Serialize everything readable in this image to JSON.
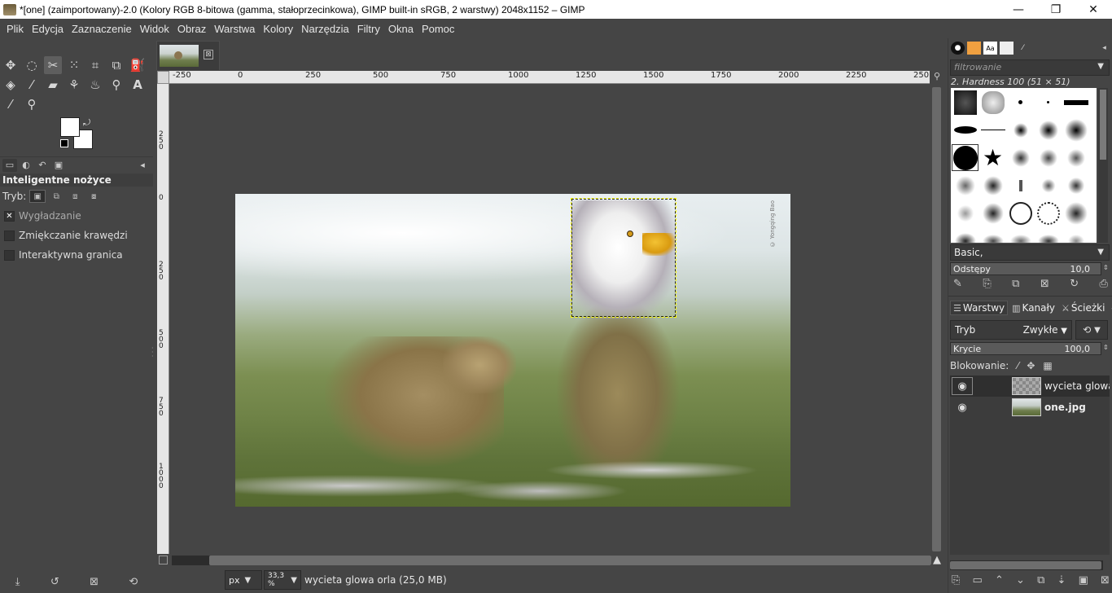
{
  "window": {
    "title": "*[one] (zaimportowany)-2.0 (Kolory RGB 8-bitowa (gamma, stałoprzecinkowa), GIMP built-in sRGB, 2 warstwy) 2048x1152 – GIMP",
    "minimize": "—",
    "maximize": "❐",
    "close": "✕"
  },
  "menu": [
    "Plik",
    "Edycja",
    "Zaznaczenie",
    "Widok",
    "Obraz",
    "Warstwa",
    "Kolory",
    "Narzędzia",
    "Filtry",
    "Okna",
    "Pomoc"
  ],
  "toolbox": {
    "tools": [
      {
        "name": "move-tool",
        "glyph": "✥"
      },
      {
        "name": "ellipse-select-tool",
        "glyph": "◌"
      },
      {
        "name": "scissors-select-tool",
        "glyph": "✂"
      },
      {
        "name": "fuzzy-select-tool",
        "glyph": "⁙"
      },
      {
        "name": "crop-tool",
        "glyph": "⌗"
      },
      {
        "name": "unified-transform-tool",
        "glyph": "⧉"
      },
      {
        "name": "warp-transform-tool",
        "glyph": "⛽"
      },
      {
        "name": "bucket-fill-tool",
        "glyph": "◈"
      },
      {
        "name": "paintbrush-tool",
        "glyph": "⁄"
      },
      {
        "name": "eraser-tool",
        "glyph": "▰"
      },
      {
        "name": "clone-tool",
        "glyph": "⚘"
      },
      {
        "name": "smudge-tool",
        "glyph": "♨"
      },
      {
        "name": "paths-tool",
        "glyph": "⚲"
      },
      {
        "name": "text-tool",
        "glyph": "A"
      },
      {
        "name": "color-picker-tool",
        "glyph": "⁄"
      },
      {
        "name": "zoom-tool",
        "glyph": "⚲"
      }
    ],
    "active_tool": "scissors-select-tool"
  },
  "tool_options": {
    "title": "Inteligentne nożyce",
    "mode_label": "Tryb:",
    "antialiasing": {
      "label": "Wygładzanie",
      "checked": true
    },
    "feather": {
      "label": "Zmiękczanie krawędzi",
      "checked": false
    },
    "interactive": {
      "label": "Interaktywna granica",
      "checked": false
    }
  },
  "image_tab": {
    "close": "⊠"
  },
  "ruler": {
    "h_labels": [
      "-250",
      "0",
      "250",
      "500",
      "750",
      "1000",
      "1250",
      "1500",
      "1750",
      "2000",
      "2250",
      "250"
    ],
    "v_labels": [
      "2 5 0",
      "0",
      "2 5 0",
      "5 0 0",
      "7 5 0",
      "1 0 0 0"
    ]
  },
  "canvas": {
    "watermark": "© Yongqing Bao"
  },
  "status": {
    "unit": "px",
    "zoom": "33,3 %",
    "text": "wycieta glowa orla (25,0 MB)"
  },
  "brushes": {
    "filter_placeholder": "filtrowanie",
    "selected_brush": "2. Hardness 100 (51 × 51)",
    "preset": "Basic,",
    "spacing_label": "Odstępy",
    "spacing_value": "10,0"
  },
  "layers_panel": {
    "tabs": [
      "Warstwy",
      "Kanały",
      "Ścieżki"
    ],
    "mode_label": "Tryb",
    "mode_value": "Zwykłe",
    "opacity_label": "Krycie",
    "opacity_value": "100,0",
    "lock_label": "Blokowanie:",
    "layers": [
      {
        "name": "wycieta glowa orla",
        "visible": true,
        "selected": true
      },
      {
        "name": "one.jpg",
        "visible": true,
        "selected": false
      }
    ]
  },
  "colors": {
    "ui_bg": "#454545",
    "selection_marching_ants": "#ffff00",
    "foreground": "#ffffff",
    "background": "#ffffff"
  }
}
